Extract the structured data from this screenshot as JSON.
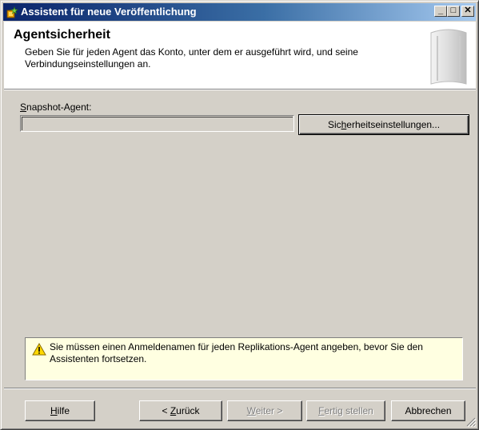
{
  "window": {
    "title": "Assistent für neue Veröffentlichung",
    "controls": {
      "minimize": "_",
      "maximize": "□",
      "close": "✕"
    },
    "title_icon": "wizard-icon"
  },
  "header": {
    "title": "Agentsicherheit",
    "subtitle": "Geben Sie für jeden Agent das Konto, unter dem er ausgeführt wird, und seine Verbindungseinstellungen an.",
    "graphic": "book-graphic"
  },
  "snapshot": {
    "label_prefix": "",
    "label_mnemonic": "S",
    "label_rest": "napshot-Agent:",
    "value": "",
    "security_button_pre": "Sic",
    "security_button_mnemonic": "h",
    "security_button_post": "erheitseinstellungen..."
  },
  "warning": {
    "icon": "warning-icon",
    "text": "Sie müssen einen Anmeldenamen für jeden Replikations-Agent angeben, bevor Sie den Assistenten fortsetzen."
  },
  "footer": {
    "help_mnemonic": "H",
    "help_rest": "ilfe",
    "back_pre": "< ",
    "back_mnemonic": "Z",
    "back_rest": "urück",
    "next_mnemonic": "W",
    "next_rest": "eiter >",
    "finish_mnemonic": "F",
    "finish_rest": "ertig stellen",
    "cancel": "Abbrechen"
  }
}
